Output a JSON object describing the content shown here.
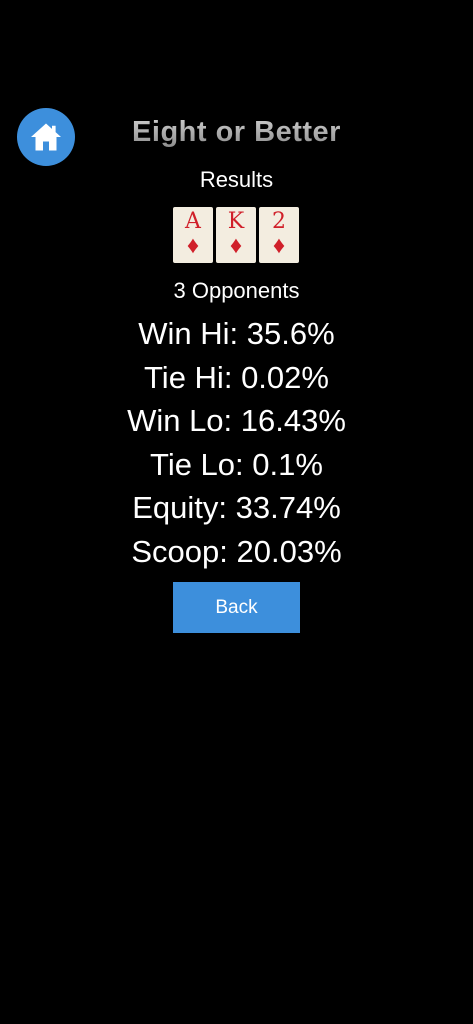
{
  "header": {
    "title": "Eight or Better",
    "subtitle": "Results",
    "home_icon": "home-icon",
    "accent_color": "#3d8fdc"
  },
  "cards": [
    {
      "rank": "A",
      "suit": "♦",
      "suit_name": "diamonds"
    },
    {
      "rank": "K",
      "suit": "♦",
      "suit_name": "diamonds"
    },
    {
      "rank": "2",
      "suit": "♦",
      "suit_name": "diamonds"
    }
  ],
  "opponents": "3 Opponents",
  "stats": {
    "win_hi": {
      "label": "Win Hi:",
      "value": "35.6%"
    },
    "tie_hi": {
      "label": "Tie Hi:",
      "value": "0.02%"
    },
    "win_lo": {
      "label": "Win Lo:",
      "value": "16.43%"
    },
    "tie_lo": {
      "label": "Tie Lo:",
      "value": "0.1%"
    },
    "equity": {
      "label": "Equity:",
      "value": "33.74%"
    },
    "scoop": {
      "label": "Scoop:",
      "value": "20.03%"
    }
  },
  "back_button": {
    "label": "Back"
  }
}
